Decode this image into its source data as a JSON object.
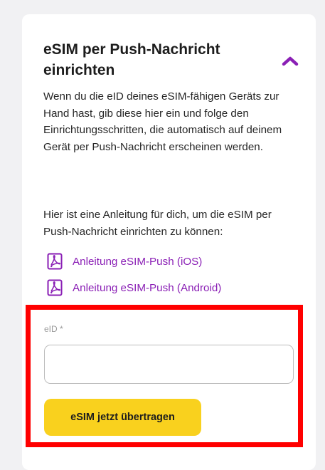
{
  "accordion": {
    "title": "eSIM per Push-Nachricht einrichten",
    "expanded": true,
    "toggle_icon": "chevron-up-icon",
    "accent_color": "#8a1fb5"
  },
  "content": {
    "description": "Wenn du die eID deines eSIM-fähigen Geräts zur Hand hast, gib diese hier ein und folge den Einrichtungsschritten, die automatisch auf deinem Gerät per Push-Nachricht erscheinen werden.",
    "guide_intro": "Hier ist eine Anleitung für dich, um die eSIM per Push-Nachricht einrichten zu können:",
    "links": [
      {
        "label": "Anleitung eSIM-Push (iOS)",
        "icon": "pdf-icon"
      },
      {
        "label": "Anleitung eSIM-Push (Android)",
        "icon": "pdf-icon"
      }
    ]
  },
  "form": {
    "eid_label": "eID *",
    "eid_value": "",
    "eid_placeholder": "",
    "submit_label": "eSIM jetzt übertragen",
    "submit_color": "#f9d11e",
    "highlight_color": "#ff0000"
  }
}
